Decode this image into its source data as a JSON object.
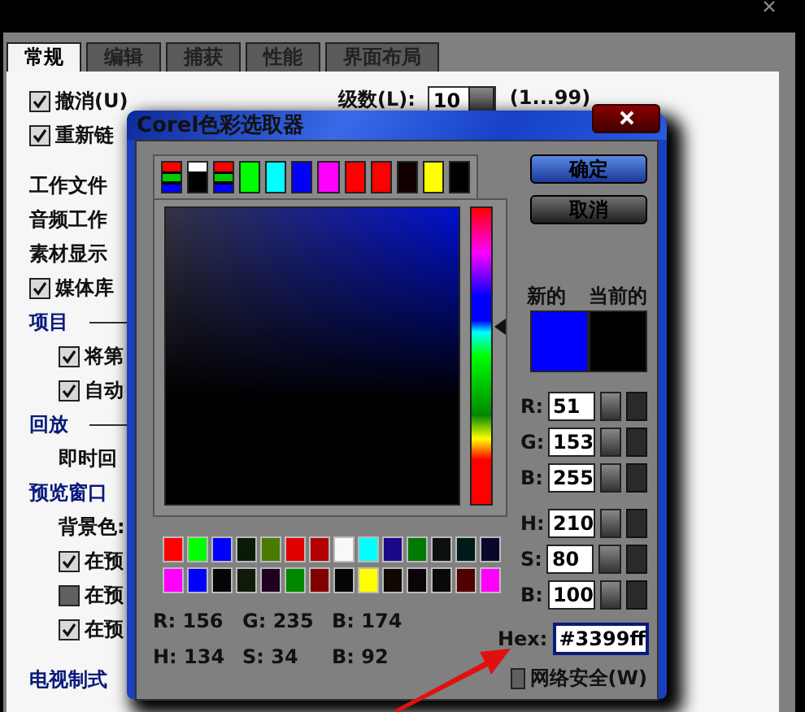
{
  "window": {
    "tabs": [
      {
        "label": "常规",
        "selected": true
      },
      {
        "label": "编辑",
        "selected": false
      },
      {
        "label": "捕获",
        "selected": false
      },
      {
        "label": "性能",
        "selected": false
      },
      {
        "label": "界面布局",
        "selected": false
      }
    ],
    "levels": {
      "label": "级数(L):",
      "value": "10",
      "range": "(1...99)"
    },
    "groups": [
      {
        "items": [
          {
            "kind": "check",
            "label": "撤消(U)",
            "checked": true
          },
          {
            "kind": "check",
            "label": "重新链",
            "checked": true
          }
        ]
      },
      {
        "items": [
          {
            "kind": "label",
            "label": "工作文件"
          },
          {
            "kind": "label",
            "label": "音频工作"
          },
          {
            "kind": "label",
            "label": "素材显示"
          },
          {
            "kind": "check",
            "label": "媒体库",
            "checked": true
          },
          {
            "kind": "section",
            "label": "项目",
            "children": [
              {
                "kind": "check",
                "label": "将第",
                "checked": true
              },
              {
                "kind": "check",
                "label": "自动",
                "checked": true
              }
            ]
          },
          {
            "kind": "section",
            "label": "回放",
            "children": [
              {
                "kind": "label",
                "label": "即时回"
              }
            ]
          },
          {
            "kind": "section",
            "label": "预览窗口",
            "children": [
              {
                "kind": "label",
                "label": "背景色:"
              },
              {
                "kind": "check",
                "label": "在预",
                "checked": true
              },
              {
                "kind": "check",
                "label": "在预",
                "checked": false
              },
              {
                "kind": "check",
                "label": "在预",
                "checked": true
              }
            ]
          }
        ]
      },
      {
        "items": [
          {
            "kind": "section",
            "label": "电视制式"
          }
        ]
      }
    ]
  },
  "dialog": {
    "title": "Corel色彩选取器",
    "swatches": [
      {
        "kind": "multi"
      },
      {
        "kind": "mono"
      },
      {
        "kind": "multi"
      },
      {
        "kind": "solid",
        "color": "#00ff00"
      },
      {
        "kind": "solid",
        "color": "#00ffff"
      },
      {
        "kind": "solid",
        "color": "#0000ff"
      },
      {
        "kind": "solid",
        "color": "#ff00ff"
      },
      {
        "kind": "solid",
        "color": "#ff0000"
      },
      {
        "kind": "solid",
        "color": "#ff0000"
      },
      {
        "kind": "solid",
        "color": "#100000"
      },
      {
        "kind": "solid",
        "color": "#ffff00"
      },
      {
        "kind": "solid",
        "color": "#000000"
      }
    ],
    "hue_slider": {
      "level": 0.6
    },
    "palette": [
      [
        {
          "color": "#ff0000"
        },
        {
          "color": "#00ff00"
        },
        {
          "color": "#0000ff"
        },
        {
          "color": "#0a1a08"
        },
        {
          "color": "#4a7a00"
        },
        {
          "color": "#e00000"
        },
        {
          "color": "#b00000"
        },
        {
          "color": "#f8f8f8"
        },
        {
          "color": "#00ffff"
        },
        {
          "color": "#1a0a8a"
        },
        {
          "color": "#007a00"
        },
        {
          "color": "#0c1010"
        },
        {
          "color": "#001a1a"
        },
        {
          "color": "#08082a"
        }
      ],
      [
        {
          "color": "#ff00ff"
        },
        {
          "color": "#0000ff"
        },
        {
          "color": "#050505"
        },
        {
          "color": "#101a08"
        },
        {
          "color": "#200020"
        },
        {
          "color": "#008800"
        },
        {
          "color": "#800000"
        },
        {
          "color": "#050505"
        },
        {
          "color": "#ffff00"
        },
        {
          "color": "#100800"
        },
        {
          "color": "#080408"
        },
        {
          "color": "#0a0a0a"
        },
        {
          "color": "#500000"
        },
        {
          "color": "#ff00ff"
        }
      ]
    ],
    "readouts": [
      [
        "R: 156",
        "G: 235",
        "B: 174"
      ],
      [
        "H: 134",
        "S: 34",
        "B: 92"
      ]
    ],
    "ok": "确定",
    "cancel": "取消",
    "previews": [
      {
        "label": "新的",
        "color": "#0000ff"
      },
      {
        "label": "当前的",
        "color": "#000000"
      }
    ],
    "fields": [
      {
        "label": "R:",
        "value": "51"
      },
      {
        "label": "G:",
        "value": "153"
      },
      {
        "label": "B:",
        "value": "255"
      },
      {
        "label": "H:",
        "value": "210"
      },
      {
        "label": "S:",
        "value": "80"
      },
      {
        "label": "B:",
        "value": "100"
      }
    ],
    "hex": {
      "label": "Hex:",
      "value": "#3399ff"
    },
    "web_safe": {
      "label": "网络安全(W)",
      "checked": false
    }
  }
}
